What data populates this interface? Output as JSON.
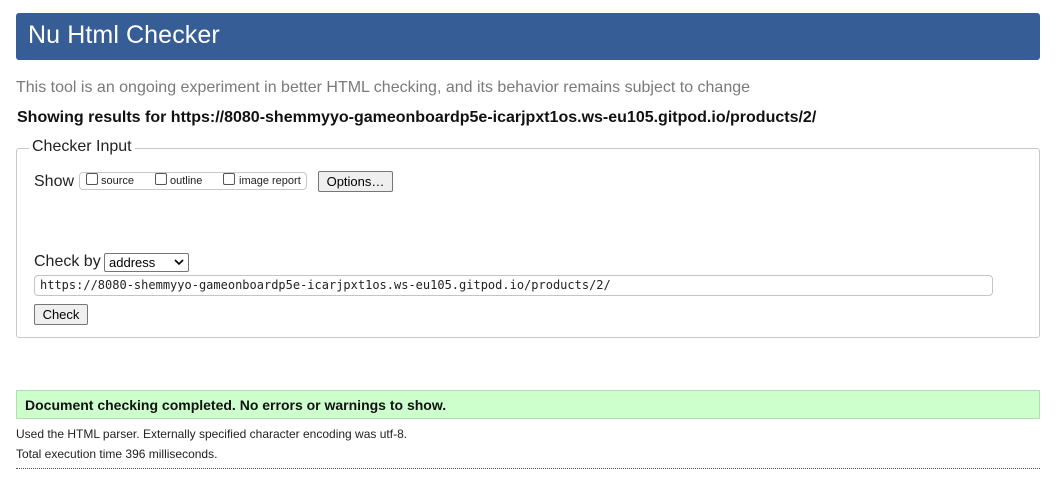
{
  "header": {
    "title": "Nu Html Checker",
    "bg_color": "#365d95"
  },
  "subtitle": "This tool is an ongoing experiment in better HTML checking, and its behavior remains subject to change",
  "results_for": "Showing results for https://8080-shemmyyo-gameonboardp5e-icarjpxt1os.ws-eu105.gitpod.io/products/2/",
  "checker_input": {
    "legend": "Checker Input",
    "show_label": "Show",
    "show_options": [
      {
        "label": "source",
        "checked": false
      },
      {
        "label": "outline",
        "checked": false
      },
      {
        "label": "image report",
        "checked": false
      }
    ],
    "options_button": "Options…",
    "check_by_label": "Check by",
    "check_by_selected": "address",
    "url_value": "https://8080-shemmyyo-gameonboardp5e-icarjpxt1os.ws-eu105.gitpod.io/products/2/",
    "check_button": "Check"
  },
  "result": {
    "message": "Document checking completed. No errors or warnings to show.",
    "bg_color": "#ccffcc",
    "parser_info": "Used the HTML parser. Externally specified character encoding was utf-8.",
    "execution_time": "Total execution time 396 milliseconds."
  }
}
